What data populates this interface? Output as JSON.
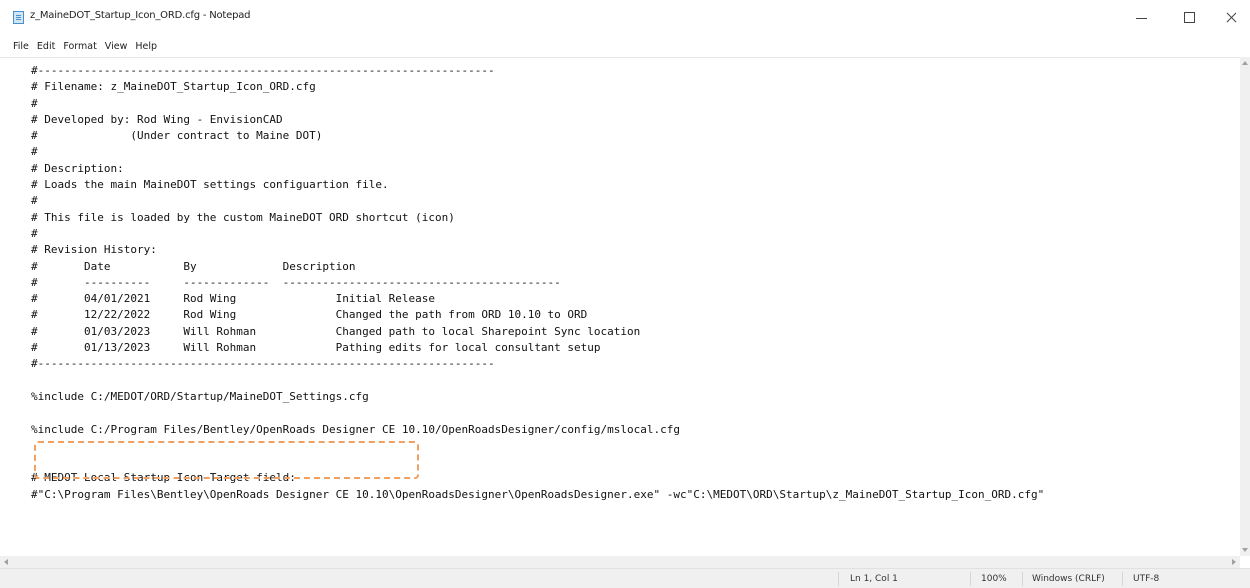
{
  "window": {
    "title": "z_MaineDOT_Startup_Icon_ORD.cfg - Notepad",
    "icon": "notepad-icon",
    "controls": [
      "minimize-icon",
      "maximize-icon",
      "close-icon"
    ]
  },
  "menu": {
    "items": [
      "File",
      "Edit",
      "Format",
      "View",
      "Help"
    ]
  },
  "editor": {
    "lines": [
      "#---------------------------------------------------------------------",
      "# Filename: z_MaineDOT_Startup_Icon_ORD.cfg",
      "#",
      "# Developed by: Rod Wing - EnvisionCAD",
      "#              (Under contract to Maine DOT)",
      "#",
      "# Description:",
      "# Loads the main MaineDOT settings configuartion file.",
      "#",
      "# This file is loaded by the custom MaineDOT ORD shortcut (icon)",
      "#",
      "# Revision History:",
      "#       Date           By             Description",
      "#       ----------     -------------  ------------------------------------------",
      "#       04/01/2021     Rod Wing               Initial Release",
      "#       12/22/2022     Rod Wing               Changed the path from ORD 10.10 to ORD",
      "#       01/03/2023     Will Rohman            Changed path to local Sharepoint Sync location",
      "#       01/13/2023     Will Rohman            Pathing edits for local consultant setup",
      "#---------------------------------------------------------------------",
      "",
      "%include C:/MEDOT/ORD/Startup/MaineDOT_Settings.cfg",
      "",
      "%include C:/Program Files/Bentley/OpenRoads Designer CE 10.10/OpenRoadsDesigner/config/mslocal.cfg",
      "",
      "",
      "# MEDOT Local Startup Icon Target field:",
      "#\"C:\\Program Files\\Bentley\\OpenRoads Designer CE 10.10\\OpenRoadsDesigner\\OpenRoadsDesigner.exe\" -wc\"C:\\MEDOT\\ORD\\Startup\\z_MaineDOT_Startup_Icon_ORD.cfg\""
    ],
    "highlighted_line_index": 20,
    "highlight_color": "#f0a060"
  },
  "status": {
    "position": "Ln 1, Col 1",
    "zoom": "100%",
    "line_endings": "Windows (CRLF)",
    "encoding": "UTF-8"
  }
}
